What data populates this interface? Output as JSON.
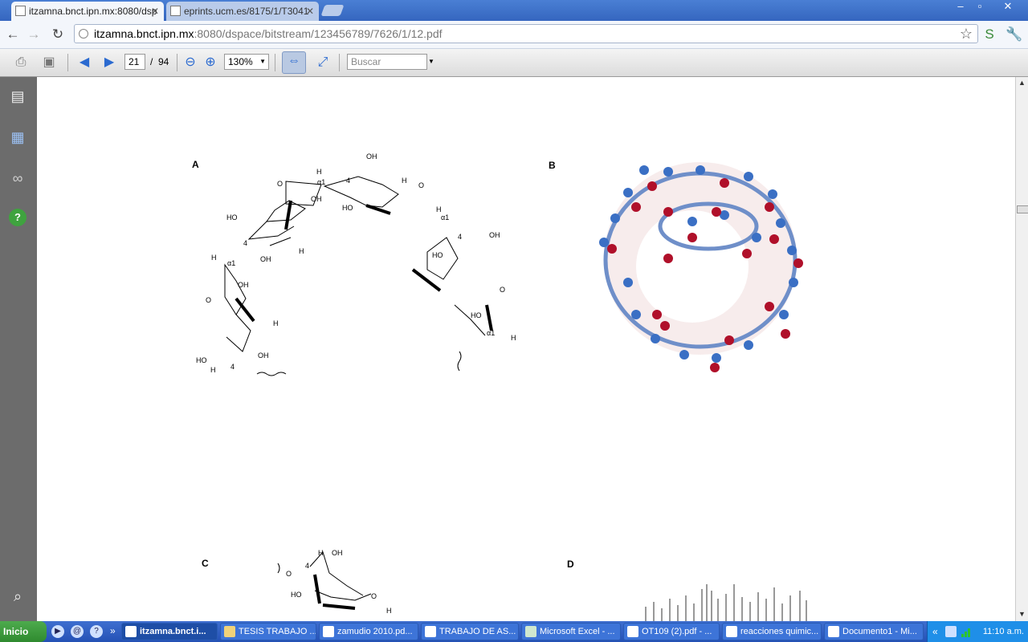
{
  "browser": {
    "tabs": [
      {
        "title": "itzamna.bnct.ipn.mx:8080/dsp",
        "active": true
      },
      {
        "title": "eprints.ucm.es/8175/1/T3041",
        "active": false
      }
    ],
    "window_controls": {
      "minimize": "–",
      "maximize": "▫",
      "close": "✕"
    },
    "url_host": "itzamna.bnct.ipn.mx",
    "url_rest": ":8080/dspace/bitstream/123456789/7626/1/12.pdf"
  },
  "pdf_toolbar": {
    "current_page": "21",
    "page_separator": "/",
    "total_pages": "94",
    "zoom": "130%",
    "search_placeholder": "Buscar"
  },
  "document": {
    "panels": [
      "A",
      "B",
      "C",
      "D"
    ],
    "structure_labels": {
      "h": "H",
      "oh": "OH",
      "ho": "HO",
      "o": "O",
      "four": "4",
      "alpha1": "α1"
    }
  },
  "taskbar": {
    "start_label": "Inicio",
    "overflow": "»",
    "tasks": [
      {
        "label": "itzamna.bnct.i...",
        "active": true,
        "icon": "chrome-icon"
      },
      {
        "label": "TESIS TRABAJO ...",
        "active": false,
        "icon": "folder-icon"
      },
      {
        "label": "zamudio 2010.pd...",
        "active": false,
        "icon": "pdf-icon"
      },
      {
        "label": "TRABAJO DE AS...",
        "active": false,
        "icon": "word-icon"
      },
      {
        "label": "Microsoft Excel - ...",
        "active": false,
        "icon": "excel-icon"
      },
      {
        "label": "OT109 (2).pdf - ...",
        "active": false,
        "icon": "pdf-icon"
      },
      {
        "label": "reacciones quimic...",
        "active": false,
        "icon": "chrome-icon"
      },
      {
        "label": "Documento1 - Mi...",
        "active": false,
        "icon": "word-icon"
      }
    ],
    "tray_chevron": "«",
    "clock": "11:10 a.m."
  },
  "colors": {
    "titlebar": "#3566bf",
    "taskbar": "#2451b5",
    "start": "#2f8a2f",
    "atom_blue": "#3a6fc4",
    "atom_red": "#b0102a"
  }
}
